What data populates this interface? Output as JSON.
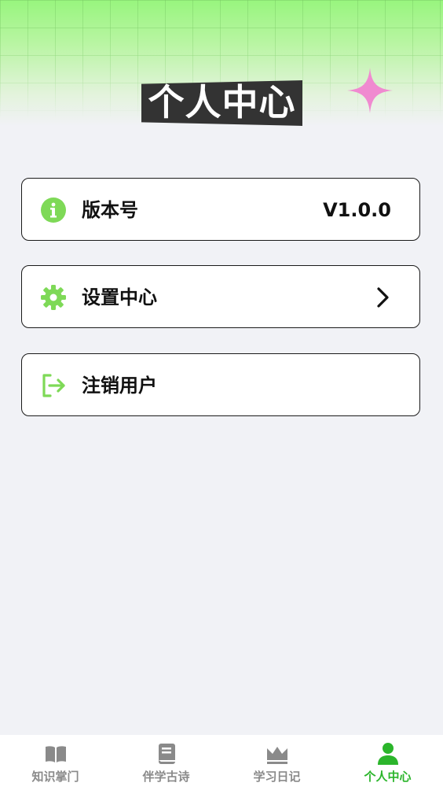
{
  "header": {
    "title": "个人中心"
  },
  "menu": {
    "version": {
      "label": "版本号",
      "value": "V1.0.0",
      "icon": "info-icon"
    },
    "settings": {
      "label": "设置中心",
      "icon": "gear-icon"
    },
    "logout": {
      "label": "注销用户",
      "icon": "logout-icon"
    }
  },
  "tabbar": {
    "items": [
      {
        "label": "知识掌门",
        "icon": "book-open-icon",
        "active": false
      },
      {
        "label": "伴学古诗",
        "icon": "book-icon",
        "active": false
      },
      {
        "label": "学习日记",
        "icon": "crown-icon",
        "active": false
      },
      {
        "label": "个人中心",
        "icon": "person-icon",
        "active": true
      }
    ]
  },
  "colors": {
    "accent": "#7ed957",
    "active_tab": "#2bb52b",
    "inactive_tab": "#8a8a8a",
    "star": "#f08ad0",
    "title_bg": "#333333",
    "page_bg": "#f1f2f6"
  }
}
